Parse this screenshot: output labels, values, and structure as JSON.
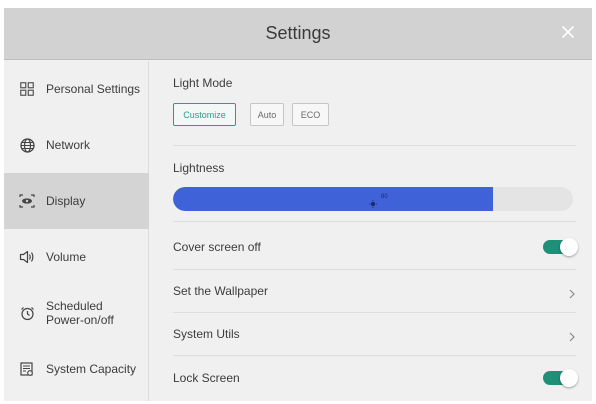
{
  "window": {
    "title": "Settings",
    "close_icon": "close-icon"
  },
  "sidebar": {
    "items": [
      {
        "label": "Personal Settings",
        "icon": "grid-icon"
      },
      {
        "label": "Network",
        "icon": "globe-icon"
      },
      {
        "label": "Display",
        "icon": "display-icon",
        "active": true
      },
      {
        "label": "Volume",
        "icon": "speaker-icon"
      },
      {
        "label": "Scheduled Power-on/off",
        "icon": "alarm-clock-icon"
      },
      {
        "label": "System Capacity",
        "icon": "storage-icon"
      }
    ]
  },
  "display": {
    "light_mode": {
      "title": "Light Mode",
      "options": [
        "Customize",
        "Auto",
        "ECO"
      ],
      "selected": "Customize"
    },
    "lightness": {
      "title": "Lightness",
      "value_text": "80",
      "value": 80,
      "max": 100
    },
    "rows": [
      {
        "label": "Cover screen off",
        "control": "toggle",
        "on": true
      },
      {
        "label": "Set the Wallpaper",
        "control": "chevron"
      },
      {
        "label": "System Utils",
        "control": "chevron"
      },
      {
        "label": "Lock Screen",
        "control": "toggle",
        "on": true
      }
    ]
  },
  "colors": {
    "accent": "#2a9c8a",
    "toggle_on": "#1f8f78",
    "slider_fill": "#3f62d8",
    "header_bg": "#d2d2d2",
    "active_nav_bg": "#d4d4d4"
  }
}
